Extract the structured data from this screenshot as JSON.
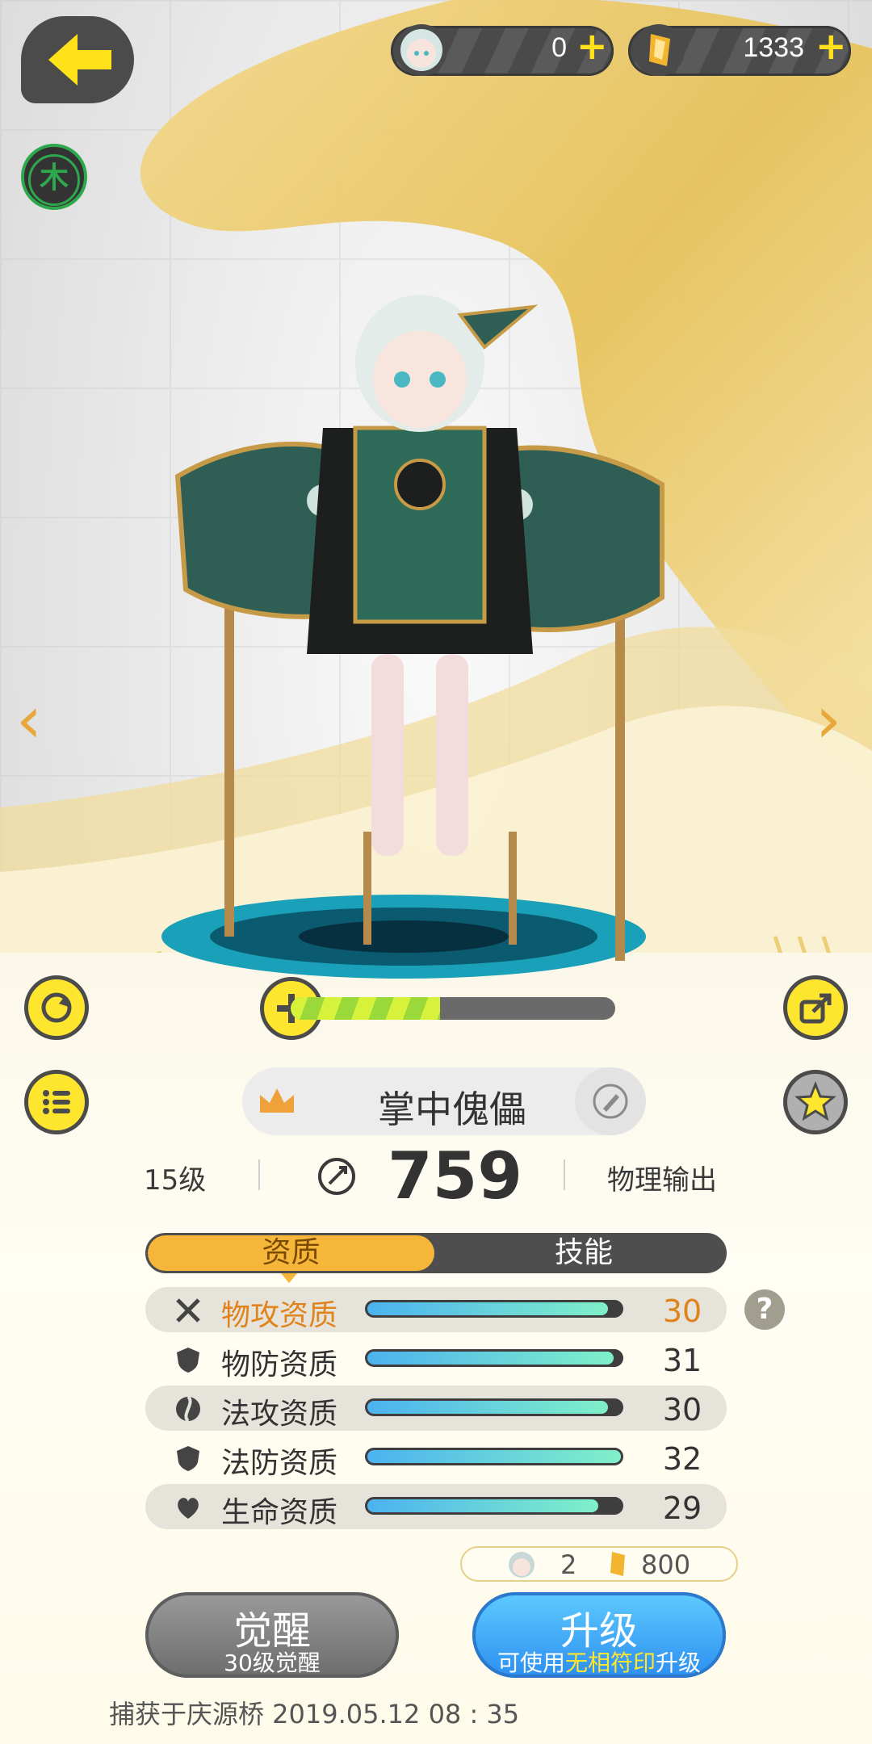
{
  "topbar": {
    "back_label": "back",
    "currency1_value": "0",
    "currency2_value": "1333",
    "plus": "+"
  },
  "element_badge": "木",
  "nav": {
    "prev": "‹",
    "next": "›"
  },
  "character": {
    "name": "掌中傀儡",
    "level": "15级",
    "power": "759",
    "role": "物理输出",
    "exp_progress": 0.46
  },
  "tabs": {
    "active": "资质",
    "other": "技能"
  },
  "stats": [
    {
      "label": "物攻资质",
      "value": "30",
      "fill": 0.95,
      "highlight": true
    },
    {
      "label": "物防资质",
      "value": "31",
      "fill": 0.97,
      "highlight": false
    },
    {
      "label": "法攻资质",
      "value": "30",
      "fill": 0.95,
      "highlight": false
    },
    {
      "label": "法防资质",
      "value": "32",
      "fill": 1.0,
      "highlight": false
    },
    {
      "label": "生命资质",
      "value": "29",
      "fill": 0.91,
      "highlight": false
    }
  ],
  "help": "?",
  "cost": {
    "item1_count": "2",
    "item2_count": "800"
  },
  "awaken_button": {
    "label": "觉醒",
    "sub": "30级觉醒"
  },
  "upgrade_button": {
    "label": "升级",
    "sub_pre": "可使用",
    "sub_hl": "无相符印",
    "sub_post": "升级"
  },
  "capture_info": "捕获于庆源桥  2019.05.12   08 : 35",
  "colors": {
    "accent": "#f6b63a",
    "highlight_text": "#e0831c",
    "button_yellow": "#ffe62e"
  }
}
